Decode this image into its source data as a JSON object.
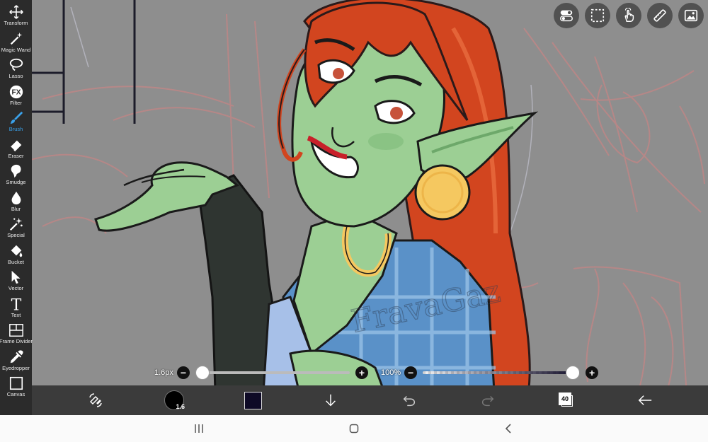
{
  "toolbar": {
    "tools": [
      {
        "label": "Transform",
        "icon": "move-arrows-icon"
      },
      {
        "label": "Magic Wand",
        "icon": "magic-wand-icon"
      },
      {
        "label": "Lasso",
        "icon": "lasso-icon"
      },
      {
        "label": "Filter",
        "icon": "fx-icon"
      },
      {
        "label": "Brush",
        "icon": "brush-icon",
        "active": true
      },
      {
        "label": "Eraser",
        "icon": "eraser-icon"
      },
      {
        "label": "Smudge",
        "icon": "smudge-icon"
      },
      {
        "label": "Blur",
        "icon": "drop-icon"
      },
      {
        "label": "Special",
        "icon": "sparkle-icon"
      },
      {
        "label": "Bucket",
        "icon": "bucket-icon"
      },
      {
        "label": "Vector",
        "icon": "cursor-arrow-icon"
      },
      {
        "label": "Text",
        "icon": "text-t-icon"
      },
      {
        "label": "Frame Divider",
        "icon": "frame-divider-icon"
      },
      {
        "label": "Eyedropper",
        "icon": "eyedropper-icon"
      },
      {
        "label": "Canvas",
        "icon": "canvas-icon"
      }
    ],
    "active_color": "#3aa0e8"
  },
  "top_right": {
    "buttons": [
      "toggle-settings-icon",
      "selection-icon",
      "touch-hand-icon",
      "ruler-icon",
      "image-icon"
    ]
  },
  "brush_size": {
    "value": "1.6px",
    "minus": "−",
    "plus": "+",
    "level": 0.0
  },
  "opacity": {
    "value": "100%",
    "minus": "−",
    "plus": "+",
    "level": 1.0
  },
  "bottom": {
    "brush_preview_value": "1.6",
    "color": "#0e0a26",
    "layers_count": "40"
  },
  "colors": {
    "toolbar_bg": "#2b2b2b",
    "bottombar_bg": "#3b3b3b",
    "canvas_bg": "#8e8e8e",
    "skin": "#9ccf94",
    "hair": "#d2451f",
    "shirt": "#5a91c8",
    "earring": "#f5c860"
  },
  "artwork": {
    "watermark": "FravaGaz"
  }
}
